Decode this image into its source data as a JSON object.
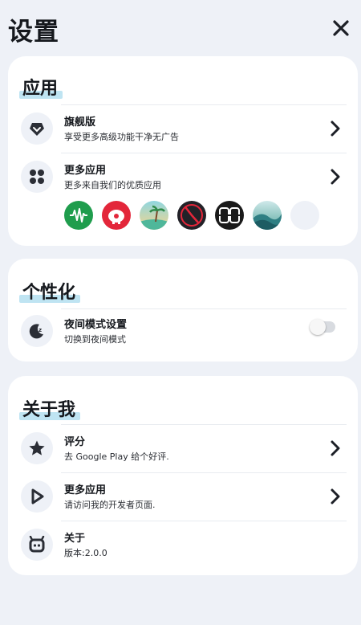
{
  "page": {
    "title": "设置",
    "close_icon": "close-icon"
  },
  "section_apps": {
    "title": "应用",
    "items": [
      {
        "title": "旗舰版",
        "subtitle": "享受更多高级功能干净无广告",
        "icon": "heart-badge-icon"
      },
      {
        "title": "更多应用",
        "subtitle": "更多来自我们的优质应用",
        "icon": "apps-grid-icon"
      }
    ],
    "apps": [
      {
        "name": "audio-wave-app-icon",
        "color": "#1f9d4d"
      },
      {
        "name": "piggy-bank-app-icon",
        "color": "#e3263a"
      },
      {
        "name": "beach-app-icon",
        "color": "#6cc6b6"
      },
      {
        "name": "clock-app-icon",
        "color": "#222228"
      },
      {
        "name": "flip-clock-app-icon",
        "color": "#1a1a1a"
      },
      {
        "name": "wave-landscape-app-icon",
        "color": "#5aa9a0"
      },
      {
        "name": "placeholder-app-icon",
        "color": "#eef1f7"
      }
    ]
  },
  "section_personal": {
    "title": "个性化",
    "items": [
      {
        "title": "夜间模式设置",
        "subtitle": "切换到夜间模式",
        "icon": "moon-icon",
        "toggle": false
      }
    ]
  },
  "section_about": {
    "title": "关于我",
    "items": [
      {
        "title": "评分",
        "subtitle": "去 Google Play 给个好评.",
        "icon": "star-icon"
      },
      {
        "title": "更多应用",
        "subtitle": "请访问我的开发者页面.",
        "icon": "play-icon"
      },
      {
        "title": "关于",
        "subtitle": "版本:2.0.0",
        "icon": "robot-icon"
      }
    ]
  },
  "colors": {
    "background": "#eef1f7",
    "card": "#ffffff",
    "highlight": "#bfe4f2",
    "text": "#15181d"
  }
}
